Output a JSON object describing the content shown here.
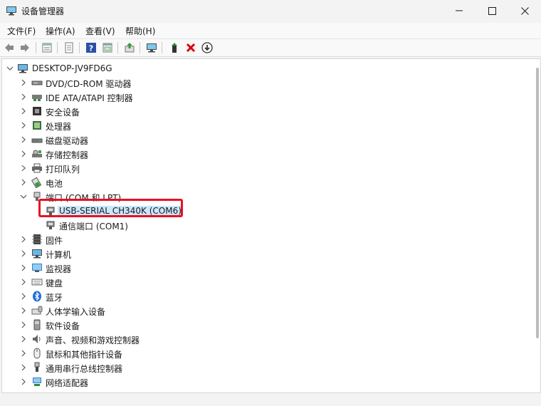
{
  "window": {
    "title": "设备管理器",
    "controls": {
      "minimize_icon": "minimize-icon",
      "maximize_icon": "maximize-icon",
      "close_icon": "close-icon"
    }
  },
  "menu": [
    "文件(F)",
    "操作(A)",
    "查看(V)",
    "帮助(H)"
  ],
  "toolbar": {
    "icons": [
      "back-arrow-icon",
      "forward-arrow-icon",
      "properties-icon",
      "document-icon",
      "help-icon",
      "console-icon",
      "update-driver-icon",
      "scan-hardware-icon",
      "enable-device-icon",
      "uninstall-device-icon",
      "download-icon"
    ]
  },
  "tree": {
    "root": "DESKTOP-JV9FD6G",
    "items": [
      {
        "label": "DVD/CD-ROM 驱动器",
        "icon": "dvd-drive-icon"
      },
      {
        "label": "IDE ATA/ATAPI 控制器",
        "icon": "ide-controller-icon"
      },
      {
        "label": "安全设备",
        "icon": "security-device-icon"
      },
      {
        "label": "处理器",
        "icon": "processor-icon"
      },
      {
        "label": "磁盘驱动器",
        "icon": "disk-drive-icon"
      },
      {
        "label": "存储控制器",
        "icon": "storage-controller-icon"
      },
      {
        "label": "打印队列",
        "icon": "printer-icon"
      },
      {
        "label": "电池",
        "icon": "battery-icon"
      },
      {
        "label": "端口 (COM 和 LPT)",
        "icon": "port-icon"
      },
      {
        "label": "USB-SERIAL CH340K (COM6)",
        "icon": "port-icon"
      },
      {
        "label": "通信端口 (COM1)",
        "icon": "port-icon"
      },
      {
        "label": "固件",
        "icon": "firmware-icon"
      },
      {
        "label": "计算机",
        "icon": "computer-icon"
      },
      {
        "label": "监视器",
        "icon": "monitor-icon"
      },
      {
        "label": "键盘",
        "icon": "keyboard-icon"
      },
      {
        "label": "蓝牙",
        "icon": "bluetooth-icon"
      },
      {
        "label": "人体学输入设备",
        "icon": "hid-icon"
      },
      {
        "label": "软件设备",
        "icon": "software-device-icon"
      },
      {
        "label": "声音、视频和游戏控制器",
        "icon": "sound-icon"
      },
      {
        "label": "鼠标和其他指针设备",
        "icon": "mouse-icon"
      },
      {
        "label": "通用串行总线控制器",
        "icon": "usb-icon"
      },
      {
        "label": "网络适配器",
        "icon": "network-adapter-icon"
      }
    ]
  },
  "colors": {
    "selection": "#cce8ff",
    "highlight_border": "#e81123",
    "window_bg": "#f3f3f3",
    "panel_bg": "#ffffff"
  }
}
